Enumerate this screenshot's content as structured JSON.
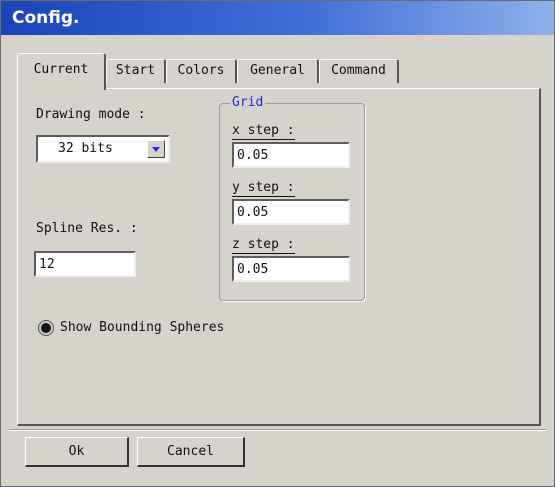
{
  "window": {
    "title": "Config."
  },
  "tabs": [
    {
      "label": "Current",
      "active": true
    },
    {
      "label": "Start",
      "active": false
    },
    {
      "label": "Colors",
      "active": false
    },
    {
      "label": "General",
      "active": false
    },
    {
      "label": "Command",
      "active": false
    }
  ],
  "current": {
    "drawing_mode_label": "Drawing mode :",
    "drawing_mode_value": "32 bits",
    "spline_label": "Spline Res. :",
    "spline_value": "12",
    "grid": {
      "title": "Grid",
      "x_label": "x step :",
      "x_value": "0.05",
      "y_label": "y step :",
      "y_value": "0.05",
      "z_label": "z step :",
      "z_value": "0.05"
    },
    "show_bounding_label": "Show Bounding Spheres",
    "show_bounding_checked": true
  },
  "buttons": {
    "ok": "Ok",
    "cancel": "Cancel"
  }
}
